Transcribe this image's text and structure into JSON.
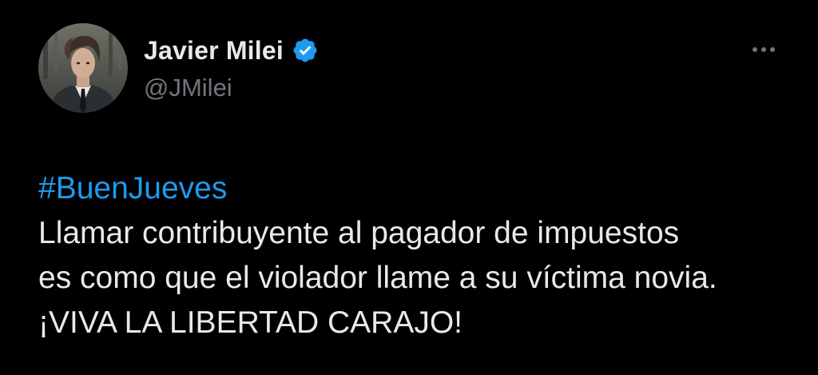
{
  "author": {
    "display_name": "Javier Milei",
    "handle": "@JMilei",
    "verified": true,
    "verified_color": "#1d9bf0"
  },
  "menu": {
    "icon": "more-options-icon"
  },
  "tweet": {
    "hashtag": "#BuenJueves",
    "lines": [
      "Llamar contribuyente al pagador de impuestos",
      "es como que el violador llame a su víctima novia.",
      "¡VIVA LA LIBERTAD CARAJO!"
    ]
  },
  "colors": {
    "background": "#000000",
    "text_primary": "#e7e9ea",
    "text_secondary": "#71767b",
    "link": "#1d9bf0"
  }
}
